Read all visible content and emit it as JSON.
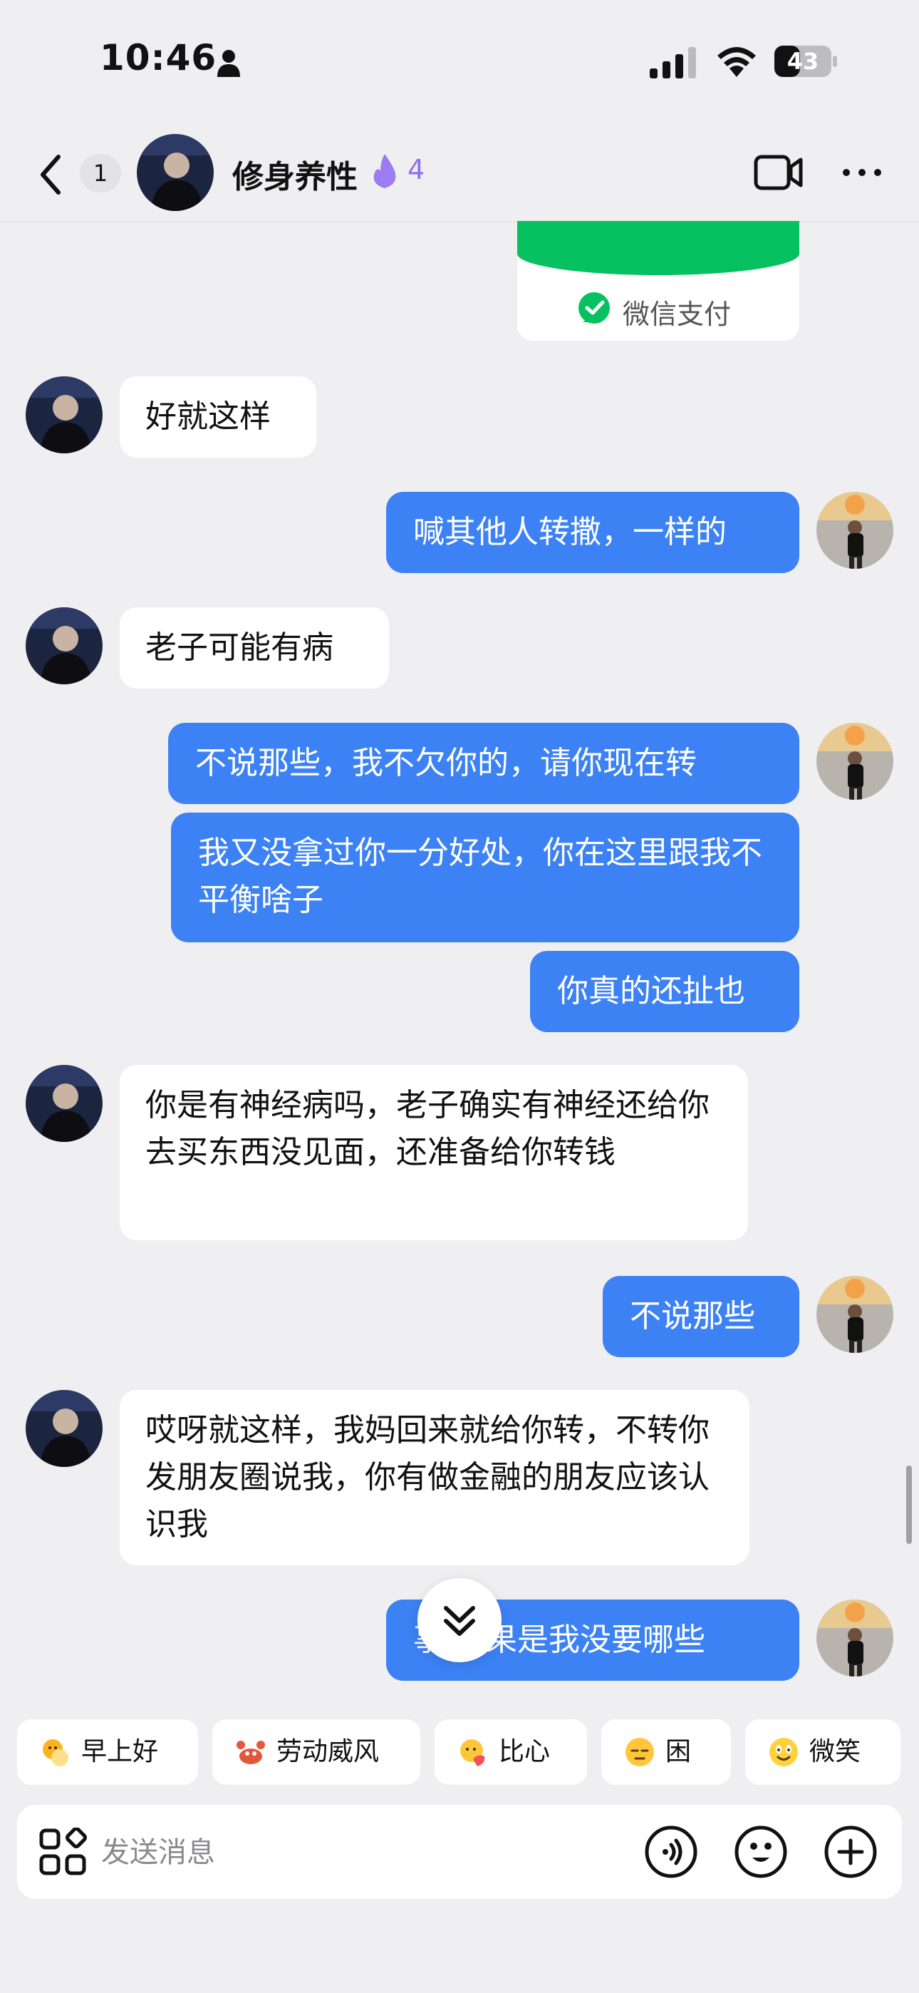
{
  "status_bar": {
    "time": "10:46",
    "battery": "43"
  },
  "header": {
    "unread_count": "1",
    "chat_name": "修身养性",
    "streak": "4"
  },
  "payment_card": {
    "label": "微信支付"
  },
  "messages": [
    {
      "side": "in",
      "text": "好就这样"
    },
    {
      "side": "out",
      "text": "喊其他人转撒，一样的"
    },
    {
      "side": "in",
      "text": "老子可能有病"
    },
    {
      "side": "out",
      "text": "不说那些，我不欠你的，请你现在转"
    },
    {
      "side": "out",
      "text": "我又没拿过你一分好处，你在这里跟我不平衡啥子"
    },
    {
      "side": "out",
      "text": "你真的还扯也"
    },
    {
      "side": "in",
      "text": "你是有神经病吗，老子确实有神经还给你去买东西没见面，还准备给你转钱"
    },
    {
      "side": "out",
      "text": "不说那些"
    },
    {
      "side": "in",
      "text": "哎呀就这样，我妈回来就给你转，不转你发朋友圈说我，你有做金融的朋友应该认识我"
    },
    {
      "side": "out",
      "text": "事 结果是我没要哪些"
    }
  ],
  "quick_replies": [
    "早上好",
    "劳动威风",
    "比心",
    "困",
    "微笑"
  ],
  "input": {
    "placeholder": "发送消息",
    "value": ""
  },
  "colors": {
    "outgoing_bubble": "#3c82f5",
    "incoming_bubble": "#ffffff",
    "background": "#efeff1",
    "accent_purple": "#8c6ff0",
    "wechat_green": "#07c160"
  },
  "icons": [
    "person-icon",
    "signal-icon",
    "wifi-icon",
    "battery-icon",
    "back-icon",
    "flame-icon",
    "video-call-icon",
    "more-icon",
    "wechat-pay-icon",
    "chevron-double-down-icon",
    "apps-icon",
    "voice-icon",
    "emoji-icon",
    "plus-icon"
  ]
}
